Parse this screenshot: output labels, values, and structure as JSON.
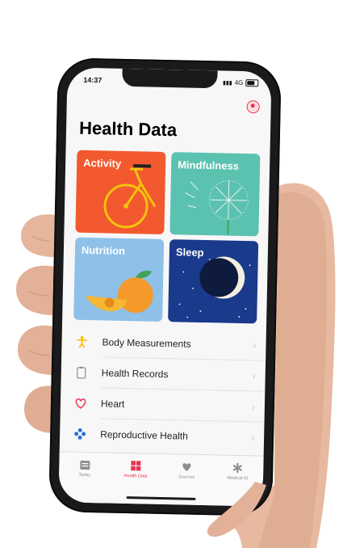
{
  "status": {
    "time": "14:37",
    "network": "4G"
  },
  "page": {
    "title": "Health Data"
  },
  "tiles": [
    {
      "label": "Activity",
      "color": "#f2592e"
    },
    {
      "label": "Mindfulness",
      "color": "#5cc2b0"
    },
    {
      "label": "Nutrition",
      "color": "#8fc0e8"
    },
    {
      "label": "Sleep",
      "color": "#1a3a8c"
    }
  ],
  "list": [
    {
      "label": "Body Measurements",
      "icon": "person-icon",
      "color": "#f4c20d"
    },
    {
      "label": "Health Records",
      "icon": "clipboard-icon",
      "color": "#8e8e93"
    },
    {
      "label": "Heart",
      "icon": "heart-icon",
      "color": "#e8334f"
    },
    {
      "label": "Reproductive Health",
      "icon": "flower-icon",
      "color": "#2b6fd6"
    }
  ],
  "tabs": [
    {
      "label": "Today",
      "icon": "calendar-icon"
    },
    {
      "label": "Health Data",
      "icon": "grid-icon"
    },
    {
      "label": "Sources",
      "icon": "heart-icon"
    },
    {
      "label": "Medical ID",
      "icon": "asterisk-icon"
    }
  ]
}
